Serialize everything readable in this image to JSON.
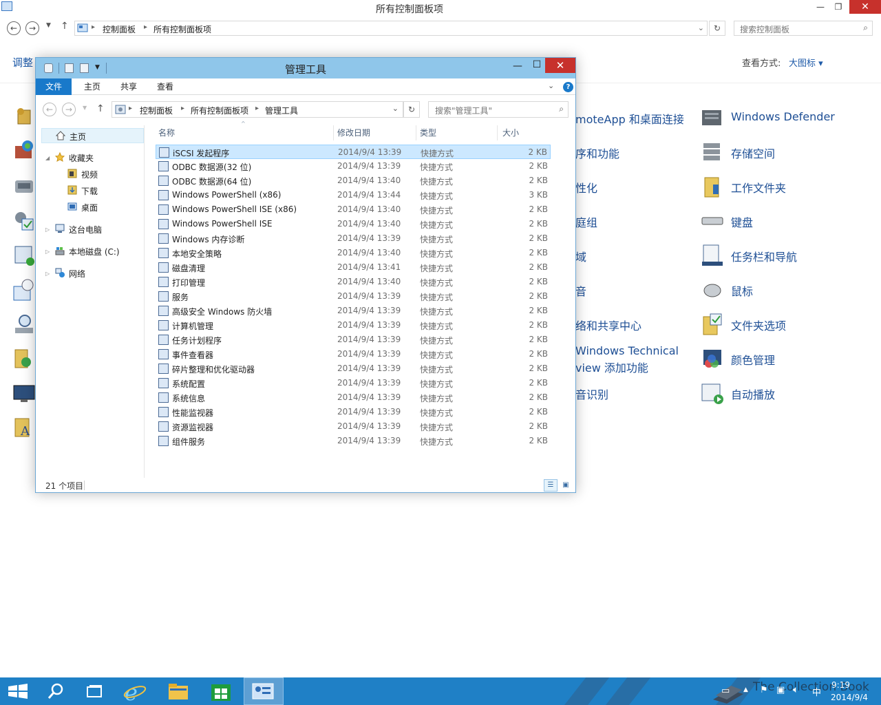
{
  "control_panel": {
    "title": "所有控制面板项",
    "breadcrumb": [
      "控制面板",
      "所有控制面板项"
    ],
    "search_placeholder": "搜索控制面板",
    "heading": "调整",
    "view_label": "查看方式:",
    "view_value": "大图标 ▾",
    "middle_items": [
      "moteApp 和桌面连接",
      "序和功能",
      "性化",
      "庭组",
      "域",
      "音",
      "络和共享中心",
      "Windows Technical",
      "view 添加功能",
      "音识别"
    ],
    "right_items": [
      {
        "label": "Windows Defender",
        "icon": "windows-defender-icon"
      },
      {
        "label": "存储空间",
        "icon": "storage-spaces-icon"
      },
      {
        "label": "工作文件夹",
        "icon": "work-folders-icon"
      },
      {
        "label": "键盘",
        "icon": "keyboard-icon"
      },
      {
        "label": "任务栏和导航",
        "icon": "taskbar-navigation-icon"
      },
      {
        "label": "鼠标",
        "icon": "mouse-icon"
      },
      {
        "label": "文件夹选项",
        "icon": "folder-options-icon"
      },
      {
        "label": "颜色管理",
        "icon": "color-management-icon"
      },
      {
        "label": "自动播放",
        "icon": "autoplay-icon"
      }
    ]
  },
  "explorer": {
    "title": "管理工具",
    "ribbon_tabs": [
      "文件",
      "主页",
      "共享",
      "查看"
    ],
    "help": "?",
    "breadcrumb": [
      "控制面板",
      "所有控制面板项",
      "管理工具"
    ],
    "search_placeholder": "搜索\"管理工具\"",
    "nav": {
      "home": "主页",
      "favorites": "收藏夹",
      "videos": "视频",
      "downloads": "下载",
      "desktop": "桌面",
      "this_pc": "这台电脑",
      "local_disk": "本地磁盘 (C:)",
      "network": "网络"
    },
    "columns": {
      "name": "名称",
      "date": "修改日期",
      "type": "类型",
      "size": "大小"
    },
    "files": [
      {
        "name": "iSCSI 发起程序",
        "date": "2014/9/4 13:39",
        "type": "快捷方式",
        "size": "2 KB"
      },
      {
        "name": "ODBC 数据源(32 位)",
        "date": "2014/9/4 13:39",
        "type": "快捷方式",
        "size": "2 KB"
      },
      {
        "name": "ODBC 数据源(64 位)",
        "date": "2014/9/4 13:40",
        "type": "快捷方式",
        "size": "2 KB"
      },
      {
        "name": "Windows PowerShell (x86)",
        "date": "2014/9/4 13:44",
        "type": "快捷方式",
        "size": "3 KB"
      },
      {
        "name": "Windows PowerShell ISE (x86)",
        "date": "2014/9/4 13:40",
        "type": "快捷方式",
        "size": "2 KB"
      },
      {
        "name": "Windows PowerShell ISE",
        "date": "2014/9/4 13:40",
        "type": "快捷方式",
        "size": "2 KB"
      },
      {
        "name": "Windows 内存诊断",
        "date": "2014/9/4 13:39",
        "type": "快捷方式",
        "size": "2 KB"
      },
      {
        "name": "本地安全策略",
        "date": "2014/9/4 13:40",
        "type": "快捷方式",
        "size": "2 KB"
      },
      {
        "name": "磁盘清理",
        "date": "2014/9/4 13:41",
        "type": "快捷方式",
        "size": "2 KB"
      },
      {
        "name": "打印管理",
        "date": "2014/9/4 13:40",
        "type": "快捷方式",
        "size": "2 KB"
      },
      {
        "name": "服务",
        "date": "2014/9/4 13:39",
        "type": "快捷方式",
        "size": "2 KB"
      },
      {
        "name": "高级安全 Windows 防火墙",
        "date": "2014/9/4 13:39",
        "type": "快捷方式",
        "size": "2 KB"
      },
      {
        "name": "计算机管理",
        "date": "2014/9/4 13:39",
        "type": "快捷方式",
        "size": "2 KB"
      },
      {
        "name": "任务计划程序",
        "date": "2014/9/4 13:39",
        "type": "快捷方式",
        "size": "2 KB"
      },
      {
        "name": "事件查看器",
        "date": "2014/9/4 13:39",
        "type": "快捷方式",
        "size": "2 KB"
      },
      {
        "name": "碎片整理和优化驱动器",
        "date": "2014/9/4 13:39",
        "type": "快捷方式",
        "size": "2 KB"
      },
      {
        "name": "系统配置",
        "date": "2014/9/4 13:39",
        "type": "快捷方式",
        "size": "2 KB"
      },
      {
        "name": "系统信息",
        "date": "2014/9/4 13:39",
        "type": "快捷方式",
        "size": "2 KB"
      },
      {
        "name": "性能监视器",
        "date": "2014/9/4 13:39",
        "type": "快捷方式",
        "size": "2 KB"
      },
      {
        "name": "资源监视器",
        "date": "2014/9/4 13:39",
        "type": "快捷方式",
        "size": "2 KB"
      },
      {
        "name": "组件服务",
        "date": "2014/9/4 13:39",
        "type": "快捷方式",
        "size": "2 KB"
      }
    ],
    "status": "21 个项目"
  },
  "taskbar": {
    "time": "9:19",
    "date": "2014/9/4",
    "ime": "中",
    "watermark": "The Collection Book",
    "buttons": [
      "start-icon",
      "search-icon",
      "task-view-icon",
      "internet-explorer-icon",
      "file-explorer-icon",
      "store-icon",
      "control-panel-icon"
    ]
  },
  "colors": {
    "accent": "#1979ca",
    "title_active": "#8fc6ea",
    "close_red": "#c7312c",
    "taskbar": "#1f80c6",
    "selection": "#cce8ff",
    "link": "#1e4f95"
  }
}
